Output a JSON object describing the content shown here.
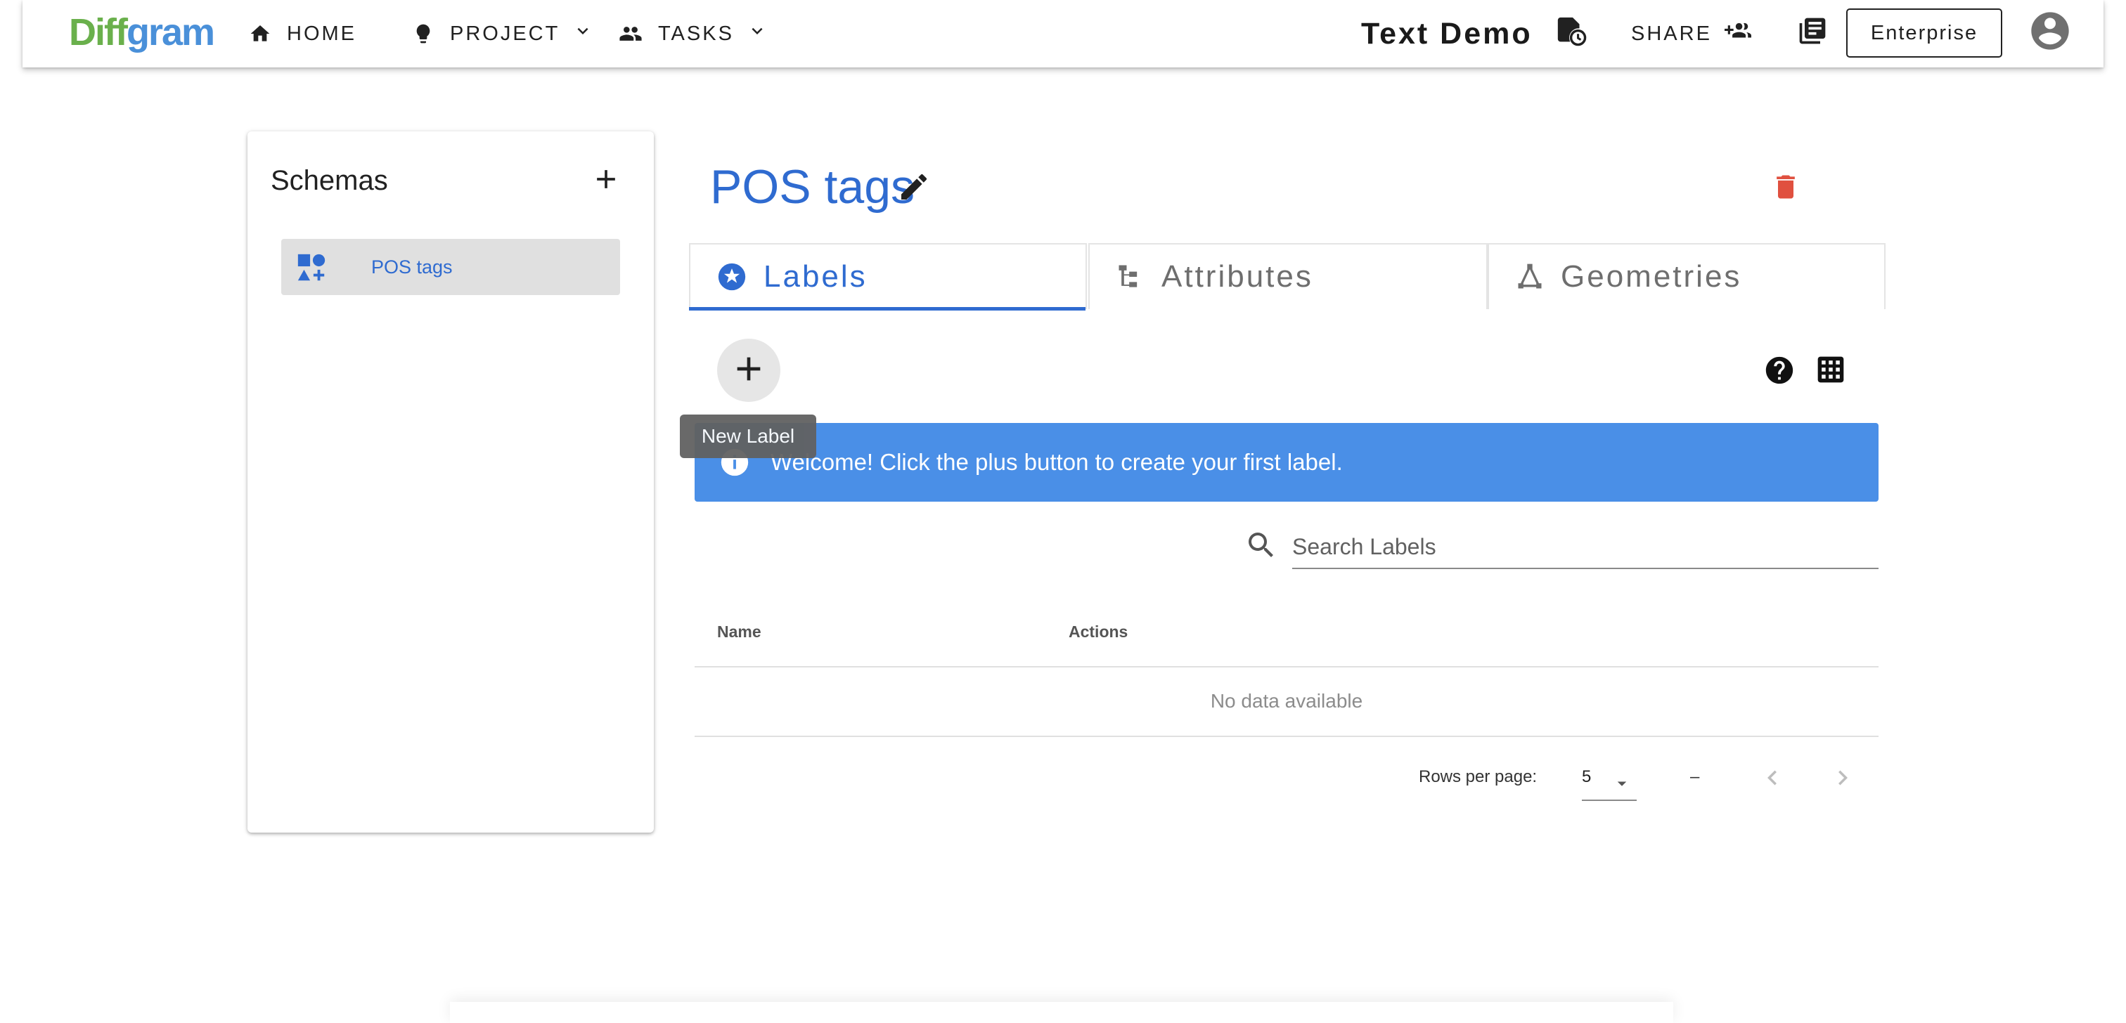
{
  "header": {
    "logo_part1": "Diff",
    "logo_part2": "gram",
    "nav": {
      "home": "HOME",
      "project": "PROJECT",
      "tasks": "TASKS"
    },
    "project_title": "Text Demo",
    "share_label": "SHARE",
    "enterprise_label": "Enterprise"
  },
  "sidebar": {
    "title": "Schemas",
    "items": [
      {
        "label": "POS tags"
      }
    ]
  },
  "main": {
    "title": "POS tags",
    "tabs": [
      {
        "label": "Labels",
        "icon": "star-circle-icon",
        "active": true
      },
      {
        "label": "Attributes",
        "icon": "file-tree-icon",
        "active": false
      },
      {
        "label": "Geometries",
        "icon": "vector-polygon-icon",
        "active": false
      }
    ],
    "tooltip": "New Label",
    "alert": "Welcome! Click the plus button to create your first label.",
    "search_placeholder": "Search Labels",
    "table": {
      "columns": [
        "Name",
        "Actions"
      ],
      "empty_text": "No data available"
    },
    "pagination": {
      "rows_per_page_label": "Rows per page:",
      "rows_per_page_value": "5",
      "page_info": "–"
    }
  },
  "colors": {
    "accent": "#2f6bd0",
    "alert_bg": "#4a8fe7",
    "delete": "#e0503f",
    "logo_green": "#6ab04c",
    "logo_blue": "#4a90d9"
  }
}
